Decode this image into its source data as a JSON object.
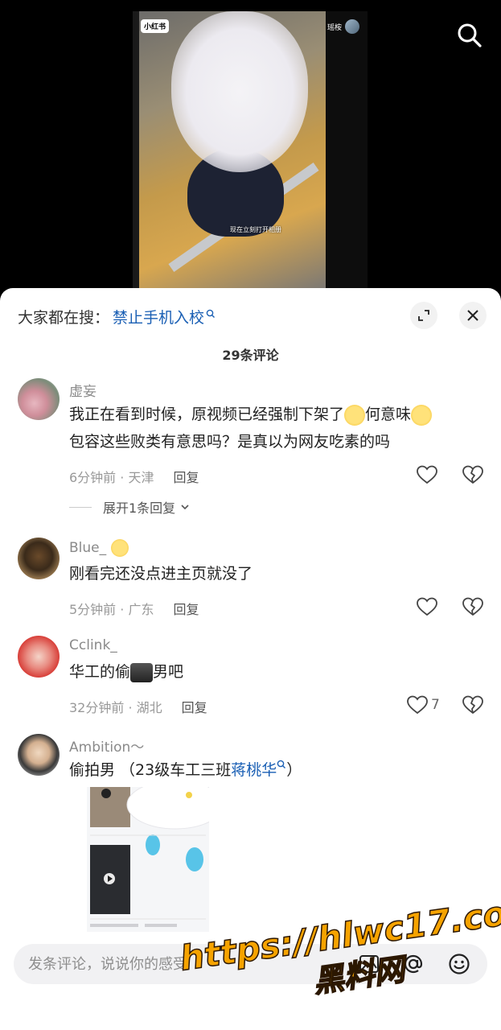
{
  "video": {
    "logo": "小红书",
    "author": "瑶桉",
    "caption": "现在立刻打开相册"
  },
  "header": {
    "search_prefix": "大家都在搜：",
    "search_keyword": "禁止手机入校",
    "comment_count": "29条评论"
  },
  "comments": [
    {
      "user": "虚妄",
      "text_line1": "我正在看到时候，原视频已经强制下架了",
      "text_mid": "何意味",
      "text_line2": "包容这些败类有意思吗？是真以为网友吃素的吗",
      "time_loc": "6分钟前 · 天津",
      "reply": "回复",
      "likes": "",
      "expand": "展开1条回复"
    },
    {
      "user": "Blue_",
      "text": "刚看完还没点进主页就没了",
      "time_loc": "5分钟前 · 广东",
      "reply": "回复",
      "likes": ""
    },
    {
      "user": "Cclink_",
      "text_a": "华工的偷",
      "text_b": "男吧",
      "time_loc": "32分钟前 · 湖北",
      "reply": "回复",
      "likes": "7"
    },
    {
      "user": "Ambition～",
      "text_a": "偷拍男 （23级车工三班",
      "text_link": "蒋桃华",
      "text_b": "）"
    }
  ],
  "input": {
    "placeholder": "发条评论，说说你的感受"
  },
  "watermark": {
    "url": "https://hlwc17.com",
    "name": "黑料网"
  }
}
